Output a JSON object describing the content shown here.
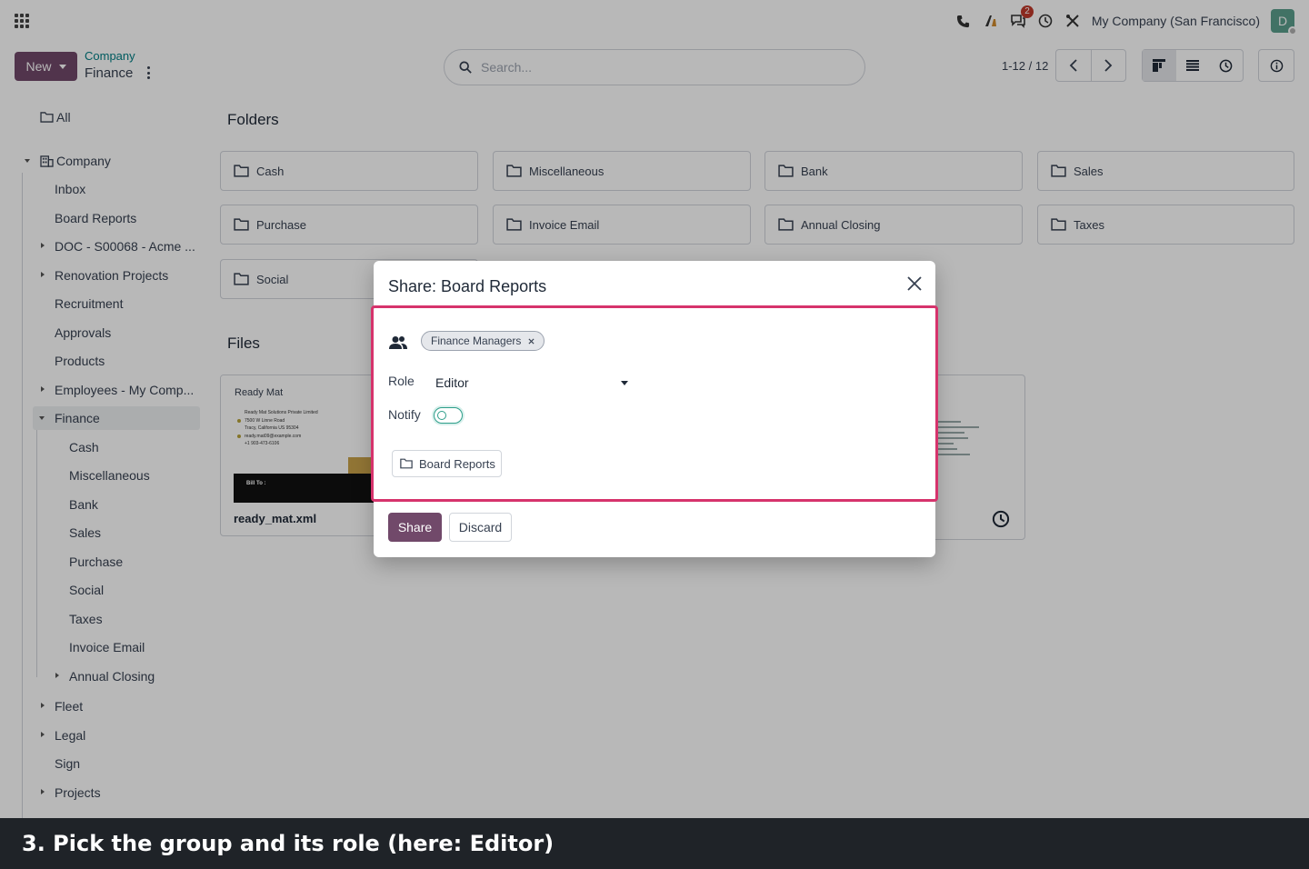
{
  "navbar": {
    "company": "My Company (San Francisco)",
    "messages_badge": "2",
    "avatar_letter": "D"
  },
  "control_panel": {
    "new_label": "New",
    "breadcrumb_parent": "Company",
    "breadcrumb_current": "Finance",
    "search_placeholder": "Search...",
    "pager": "1-12 / 12"
  },
  "sidebar": {
    "all": "All",
    "company": "Company",
    "items": [
      "Inbox",
      "Board Reports",
      "DOC - S00068 - Acme ...",
      "Renovation Projects",
      "Recruitment",
      "Approvals",
      "Products",
      "Employees - My Comp...",
      "Finance",
      "Cash",
      "Miscellaneous",
      "Bank",
      "Sales",
      "Purchase",
      "Social",
      "Taxes",
      "Invoice Email",
      "Annual Closing",
      "Fleet",
      "Legal",
      "Sign",
      "Projects"
    ]
  },
  "main": {
    "folders_title": "Folders",
    "folders": [
      "Cash",
      "Miscellaneous",
      "Bank",
      "Sales",
      "Purchase",
      "Invoice Email",
      "Annual Closing",
      "Taxes",
      "Social"
    ],
    "files_title": "Files",
    "file_preview": {
      "title": "Ready Mat",
      "lines": [
        "Ready Mat Solutions Private Limited",
        "7500 W Linne Road",
        "Tracy, California US 95304",
        "ready.mat09@example.com",
        "+1 903-473-6106"
      ],
      "bill_to": "Bill To :"
    },
    "file_name": "ready_mat.xml"
  },
  "dialog": {
    "title": "Share: Board Reports",
    "tag": "Finance Managers",
    "role_label": "Role",
    "role_value": "Editor",
    "notify_label": "Notify",
    "folder_chip": "Board Reports",
    "share_label": "Share",
    "discard_label": "Discard"
  },
  "caption": "3. Pick the group and its role (here: Editor)"
}
